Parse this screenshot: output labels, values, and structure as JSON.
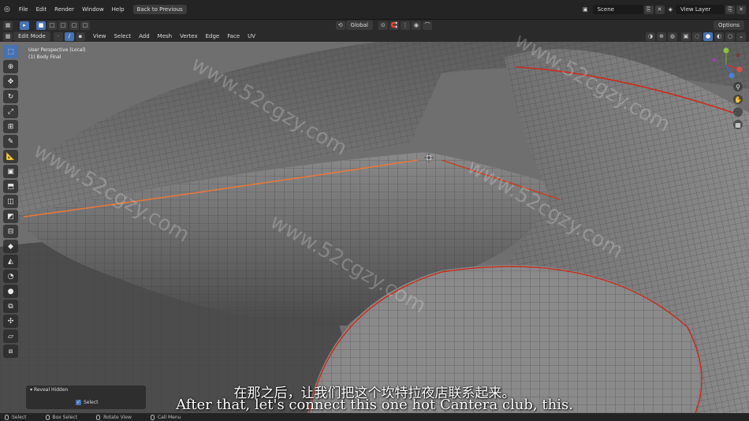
{
  "top_menu": {
    "items": [
      "File",
      "Edit",
      "Render",
      "Window",
      "Help"
    ],
    "back_button": "Back to Previous",
    "scene_label": "Scene",
    "view_layer_label": "View Layer"
  },
  "tool_header": {
    "transform_orientation": "Global",
    "options_label": "Options"
  },
  "mode_header": {
    "mode": "Edit Mode",
    "menus": [
      "View",
      "Select",
      "Add",
      "Mesh",
      "Vertex",
      "Edge",
      "Face",
      "UV"
    ]
  },
  "viewport": {
    "view_name": "User Perspective (Local)",
    "object_name": "(1) Body Final"
  },
  "toolbar_tools": [
    "select-box",
    "cursor",
    "move",
    "rotate",
    "scale",
    "transform",
    "annotate",
    "measure",
    "add-cube",
    "extrude",
    "inset",
    "bevel",
    "loop-cut",
    "knife",
    "poly-build",
    "spin",
    "smooth",
    "edge-slide",
    "shrink-fatten",
    "shear",
    "rip"
  ],
  "redo_panel": {
    "title": "Reveal Hidden",
    "select_label": "Select",
    "select_checked": true
  },
  "status_bar": {
    "items": [
      "Select",
      "Box Select",
      "Rotate View",
      "Call Menu"
    ]
  },
  "subtitles": {
    "chinese": "在那之后，让我们把这个坎特拉夜店联系起来。",
    "english": "After that, let's connect this one hot Cantera club, this."
  },
  "watermark_text": "www.52cgzy.com",
  "colors": {
    "accent": "#4772b3",
    "mesh_gray": "#7a7a7a",
    "seam_orange": "#e8783a",
    "seam_red": "#cc2a1a"
  }
}
